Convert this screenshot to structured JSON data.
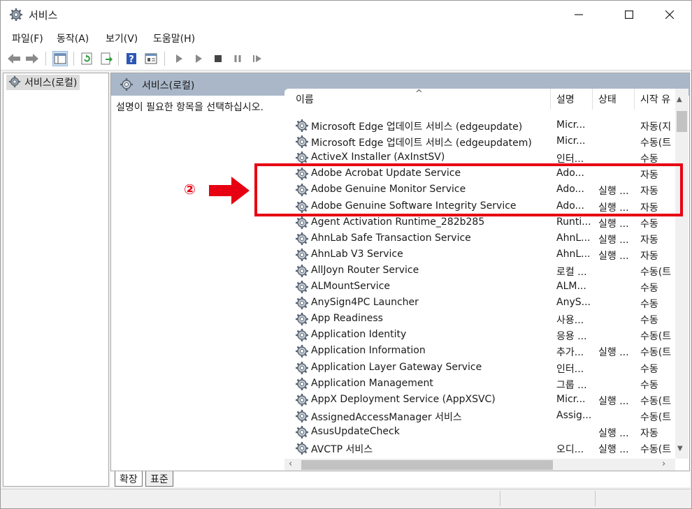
{
  "window": {
    "title": "서비스"
  },
  "menu": [
    "파일(F)",
    "동작(A)",
    "보기(V)",
    "도움말(H)"
  ],
  "tree": {
    "root_label": "서비스(로컬)"
  },
  "pane": {
    "header": "서비스(로컬)",
    "description_prompt": "설명이 필요한 항목을 선택하십시오."
  },
  "columns": [
    "이름",
    "설명",
    "상태",
    "시작 유"
  ],
  "services": [
    {
      "name": "Microsoft Edge 업데이트 서비스 (edgeupdate)",
      "desc": "Micr...",
      "status": "",
      "startup": "자동(지"
    },
    {
      "name": "Microsoft Edge 업데이트 서비스 (edgeupdatem)",
      "desc": "Micr...",
      "status": "",
      "startup": "수동(트"
    },
    {
      "name": "ActiveX Installer (AxInstSV)",
      "desc": "인터...",
      "status": "",
      "startup": "수동"
    },
    {
      "name": "Adobe Acrobat Update Service",
      "desc": "Ado...",
      "status": "",
      "startup": "자동"
    },
    {
      "name": "Adobe Genuine Monitor Service",
      "desc": "Ado...",
      "status": "실행 ...",
      "startup": "자동"
    },
    {
      "name": "Adobe Genuine Software Integrity Service",
      "desc": "Ado...",
      "status": "실행 ...",
      "startup": "자동"
    },
    {
      "name": "Agent Activation Runtime_282b285",
      "desc": "Runti...",
      "status": "실행 ...",
      "startup": "수동"
    },
    {
      "name": "AhnLab Safe Transaction Service",
      "desc": "AhnL...",
      "status": "실행 ...",
      "startup": "자동"
    },
    {
      "name": "AhnLab V3 Service",
      "desc": "AhnL...",
      "status": "실행 ...",
      "startup": "자동"
    },
    {
      "name": "AllJoyn Router Service",
      "desc": "로컬 ...",
      "status": "",
      "startup": "수동(트"
    },
    {
      "name": "ALMountService",
      "desc": "ALM...",
      "status": "",
      "startup": "수동"
    },
    {
      "name": "AnySign4PC Launcher",
      "desc": "AnyS...",
      "status": "",
      "startup": "수동"
    },
    {
      "name": "App Readiness",
      "desc": "사용...",
      "status": "",
      "startup": "수동"
    },
    {
      "name": "Application Identity",
      "desc": "응용 ...",
      "status": "",
      "startup": "수동(트"
    },
    {
      "name": "Application Information",
      "desc": "추가...",
      "status": "실행 ...",
      "startup": "수동(트"
    },
    {
      "name": "Application Layer Gateway Service",
      "desc": "인터...",
      "status": "",
      "startup": "수동"
    },
    {
      "name": "Application Management",
      "desc": "그룹 ...",
      "status": "",
      "startup": "수동"
    },
    {
      "name": "AppX Deployment Service (AppXSVC)",
      "desc": "Micr...",
      "status": "실행 ...",
      "startup": "수동(트"
    },
    {
      "name": "AssignedAccessManager 서비스",
      "desc": "Assig...",
      "status": "",
      "startup": "수동(트"
    },
    {
      "name": "AsusUpdateCheck",
      "desc": "",
      "status": "실행 ...",
      "startup": "자동"
    },
    {
      "name": "AVCTP 서비스",
      "desc": "오디...",
      "status": "실행 ...",
      "startup": "수동(트"
    }
  ],
  "tabs": [
    "확장",
    "표준"
  ],
  "annotation": {
    "number": "②"
  },
  "colors": {
    "annotation_red": "#e60012",
    "pane_header": "#a9b7c9"
  }
}
